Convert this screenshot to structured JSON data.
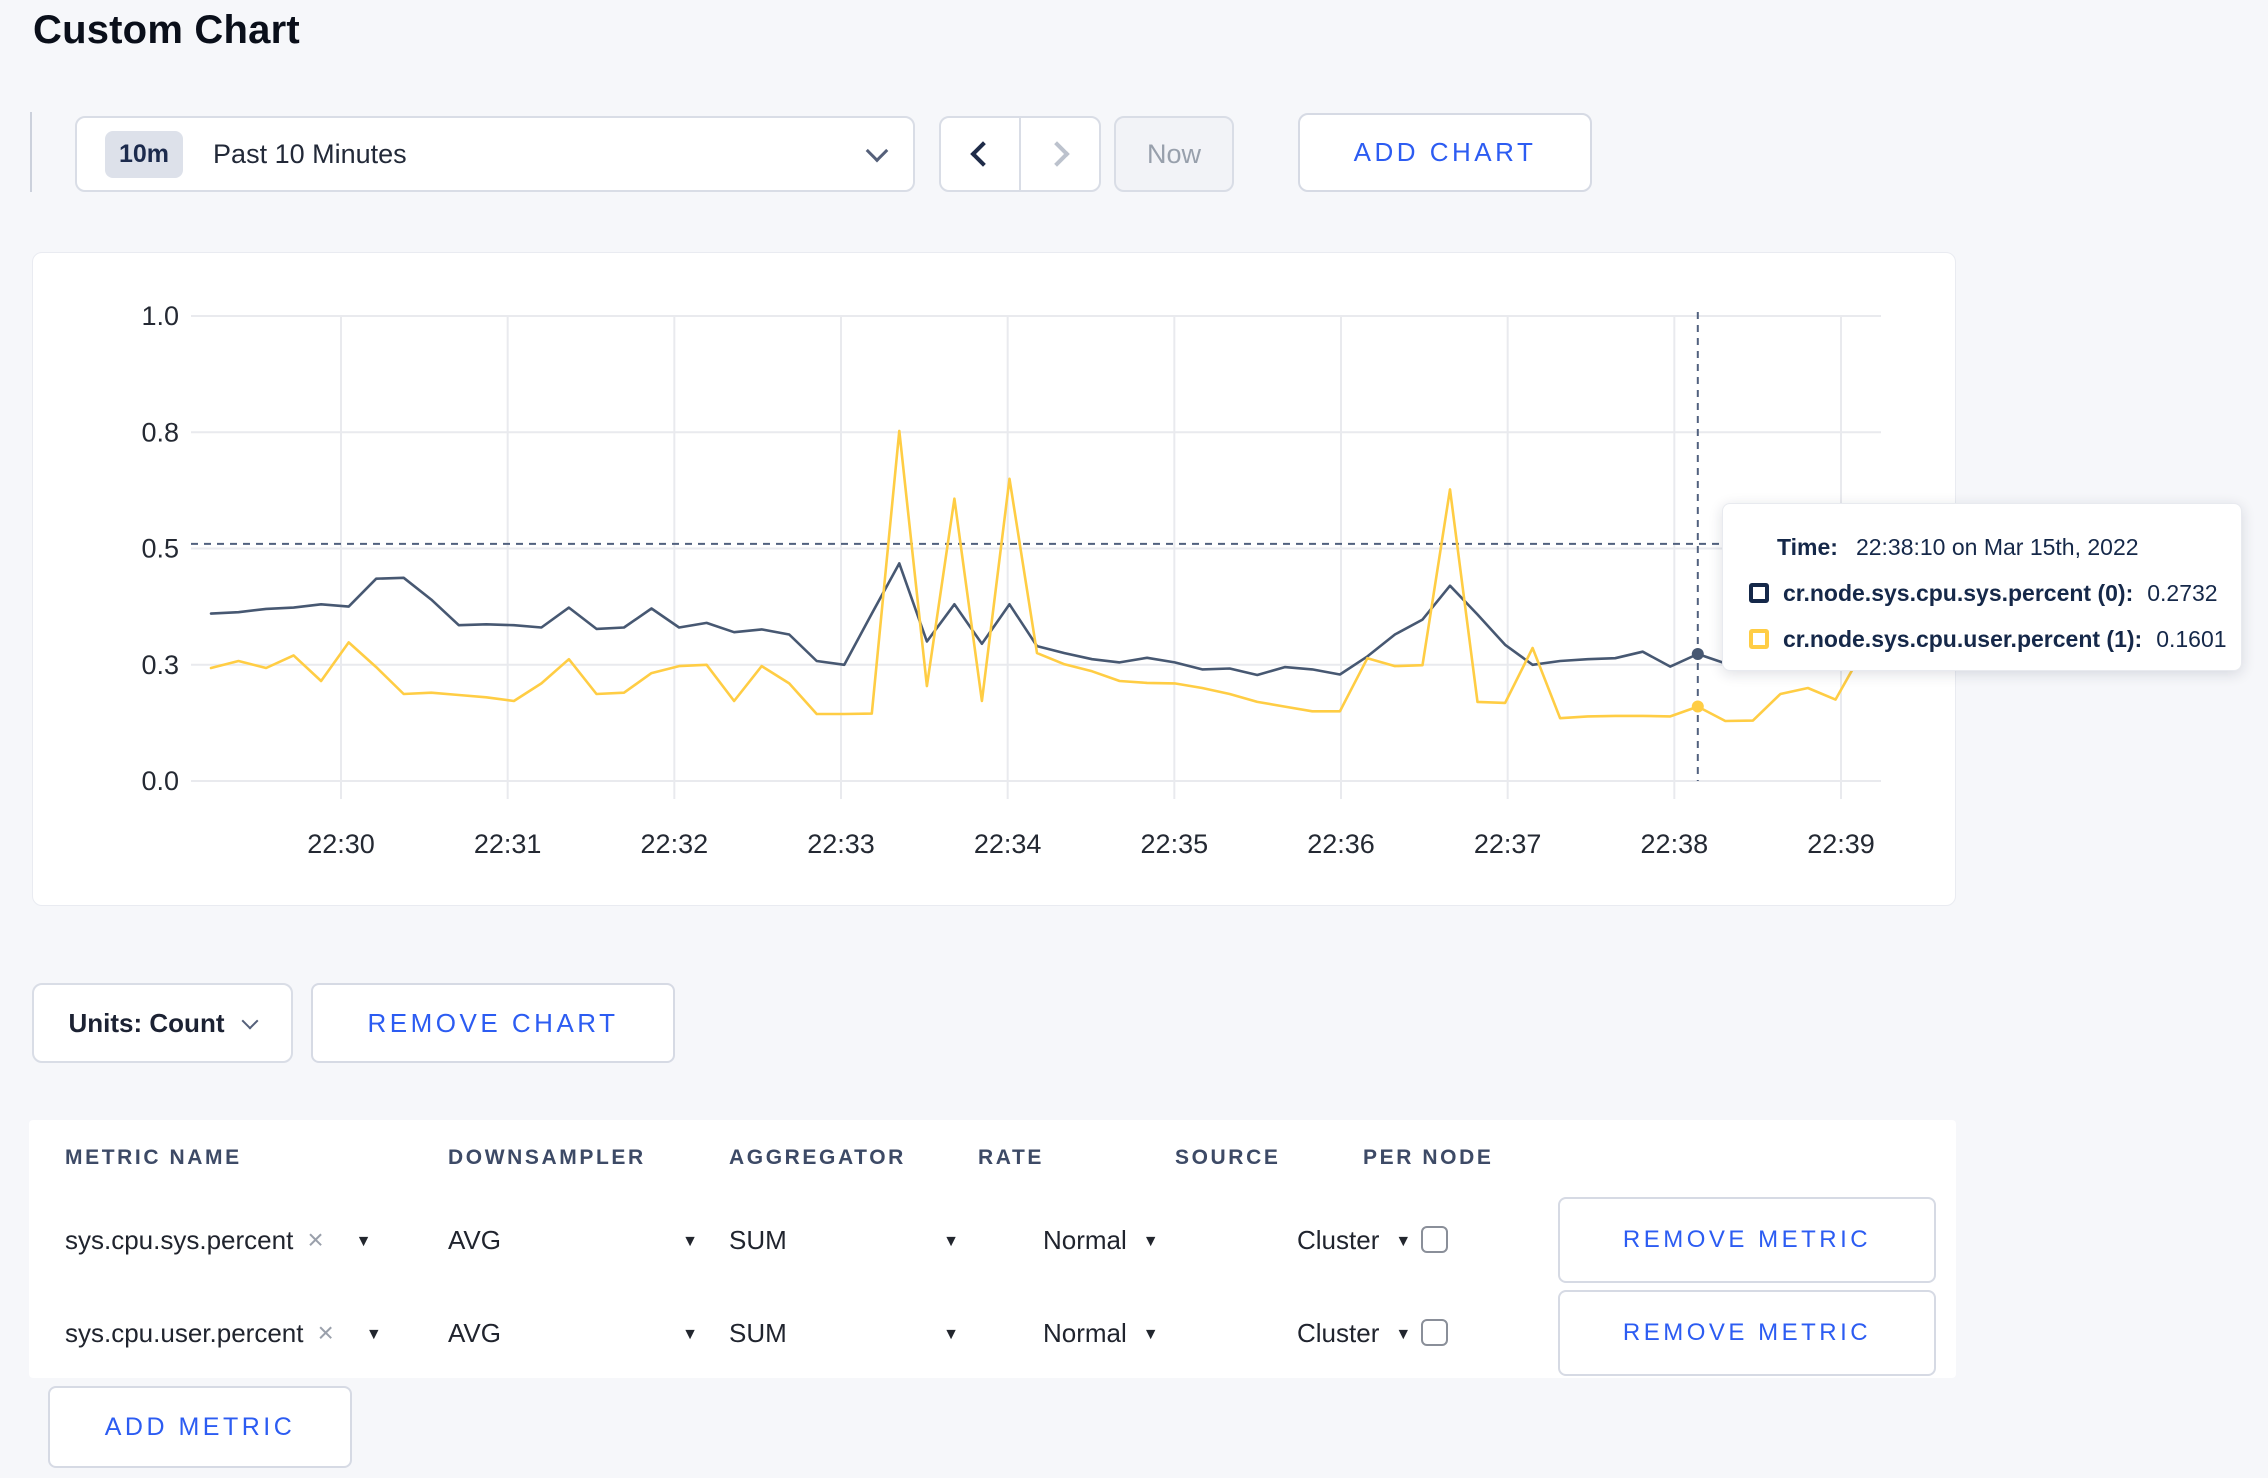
{
  "page": {
    "title": "Custom Chart",
    "background": "#f6f7fa"
  },
  "icons": {
    "caret_down": "▼",
    "close": "×"
  },
  "toolbar": {
    "time_selector": {
      "badge": "10m",
      "label": "Past 10 Minutes"
    },
    "now_label": "Now",
    "add_chart_label": "ADD CHART"
  },
  "tooltip": {
    "time_label": "Time:",
    "time_value": "22:38:10 on Mar 15th, 2022",
    "series": [
      {
        "name": "cr.node.sys.cpu.sys.percent (0):",
        "value": "0.2732",
        "color": "#152849"
      },
      {
        "name": "cr.node.sys.cpu.user.percent (1):",
        "value": "0.1601",
        "color": "#ffcd44"
      }
    ]
  },
  "chart_data": {
    "type": "line",
    "title": "",
    "xlabel": "",
    "ylabel": "",
    "x_start": "22:29:10",
    "x_step_seconds": 10,
    "x_ticks": [
      "22:30",
      "22:31",
      "22:32",
      "22:33",
      "22:34",
      "22:35",
      "22:36",
      "22:37",
      "22:38",
      "22:39"
    ],
    "ylim": [
      0.0,
      1.0
    ],
    "y_tick_values": [
      1.0,
      0.75,
      0.5,
      0.25,
      0.0
    ],
    "y_tick_labels": [
      "1.0",
      "0.8",
      "0.5",
      "0.3",
      "0.0"
    ],
    "grid": true,
    "colors": {
      "grid": "#e9eaee",
      "axis_text": "#242933",
      "crosshair": "#51617e"
    },
    "series": [
      {
        "name": "cr.node.sys.cpu.sys.percent",
        "color": "#475872",
        "values": [
          0.36,
          0.363,
          0.37,
          0.373,
          0.38,
          0.375,
          0.435,
          0.437,
          0.39,
          0.335,
          0.337,
          0.335,
          0.33,
          0.373,
          0.327,
          0.33,
          0.371,
          0.33,
          0.34,
          0.32,
          0.326,
          0.315,
          0.258,
          0.25,
          0.36,
          0.468,
          0.3,
          0.38,
          0.295,
          0.38,
          0.29,
          0.275,
          0.262,
          0.255,
          0.265,
          0.255,
          0.24,
          0.242,
          0.228,
          0.245,
          0.24,
          0.229,
          0.268,
          0.315,
          0.347,
          0.42,
          0.358,
          0.293,
          0.25,
          0.258,
          0.262,
          0.264,
          0.278,
          0.246,
          0.2732,
          0.253,
          0.245,
          0.255,
          0.26,
          0.285,
          0.31
        ]
      },
      {
        "name": "cr.node.sys.cpu.user.percent",
        "color": "#ffcd44",
        "values": [
          0.243,
          0.258,
          0.243,
          0.27,
          0.215,
          0.298,
          0.245,
          0.187,
          0.19,
          0.185,
          0.18,
          0.172,
          0.21,
          0.262,
          0.187,
          0.19,
          0.232,
          0.247,
          0.25,
          0.172,
          0.247,
          0.21,
          0.144,
          0.144,
          0.145,
          0.753,
          0.204,
          0.607,
          0.172,
          0.65,
          0.275,
          0.251,
          0.236,
          0.215,
          0.211,
          0.21,
          0.2,
          0.187,
          0.17,
          0.16,
          0.15,
          0.15,
          0.264,
          0.247,
          0.249,
          0.627,
          0.17,
          0.168,
          0.286,
          0.135,
          0.139,
          0.14,
          0.14,
          0.139,
          0.1601,
          0.129,
          0.13,
          0.187,
          0.2,
          0.175,
          0.28
        ]
      }
    ],
    "crosshair": {
      "time": "22:38:10",
      "index": 54,
      "hline_value": 0.51,
      "marker_values": [
        0.2732,
        0.1601
      ]
    },
    "legend_position": "tooltip-overlay"
  },
  "units_bar": {
    "units_label": "Units: Count",
    "remove_chart_label": "REMOVE CHART"
  },
  "metrics_table": {
    "headers": [
      "METRIC NAME",
      "DOWNSAMPLER",
      "AGGREGATOR",
      "RATE",
      "SOURCE",
      "PER NODE"
    ],
    "rows": [
      {
        "metric": "sys.cpu.sys.percent",
        "downsampler": "AVG",
        "aggregator": "SUM",
        "rate": "Normal",
        "source": "Cluster",
        "per_node_checked": false,
        "remove_label": "REMOVE METRIC"
      },
      {
        "metric": "sys.cpu.user.percent",
        "downsampler": "AVG",
        "aggregator": "SUM",
        "rate": "Normal",
        "source": "Cluster",
        "per_node_checked": false,
        "remove_label": "REMOVE METRIC"
      }
    ],
    "add_metric_label": "ADD METRIC"
  }
}
